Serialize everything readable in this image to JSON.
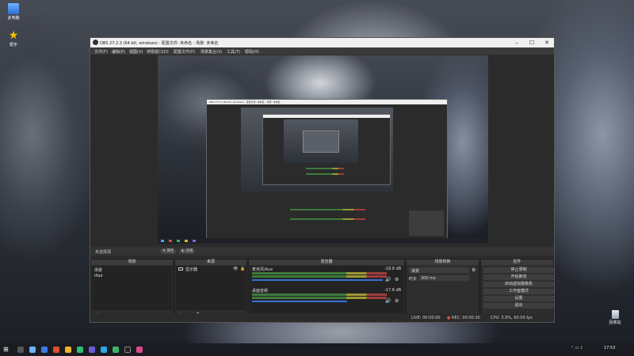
{
  "desktop": {
    "icons": [
      {
        "label": "此电脑"
      },
      {
        "label": "帮手"
      },
      {
        "label": "回收站"
      }
    ]
  },
  "window": {
    "title": "OBS 27.2.3 (64-bit, windows) - 配置文件: 未命名 - 场景: 未命名",
    "controls": {
      "minimize": "–",
      "maximize": "☐",
      "close": "✕"
    }
  },
  "menu": [
    "文件(F)",
    "编辑(E)",
    "视图(V)",
    "停靠窗口(D)",
    "配置文件(P)",
    "场景集合(S)",
    "工具(T)",
    "帮助(H)"
  ],
  "nested_preview": {
    "title": "OBS 27.2.3 (64-bit, windows) - 配置文件: 未命名 - 场景: 未命名"
  },
  "scene_bar": {
    "label": "未选择源",
    "properties": "属性",
    "filters": "滤镜"
  },
  "docks": {
    "scenes": {
      "header": "场景",
      "items": [
        "场景",
        "iPad"
      ],
      "footer": [
        "+",
        "–",
        "∧",
        "∨"
      ]
    },
    "sources": {
      "header": "来源",
      "items": [
        {
          "name": "显示器"
        }
      ],
      "footer": [
        "+",
        "–",
        "⚙",
        "∧",
        "∨"
      ]
    },
    "mixer": {
      "header": "混音器",
      "channels": [
        {
          "name": "麦克风/Aux",
          "db": "-18.8 dB"
        },
        {
          "name": "桌面音频",
          "db": "-17.6 dB"
        }
      ],
      "speaker_icon": "🔊"
    },
    "transitions": {
      "header": "场景转换",
      "type": "渐变",
      "duration_label": "时长",
      "duration": "300 ms"
    },
    "controls": {
      "header": "控件",
      "buttons": [
        "停止录制",
        "开始推流",
        "启动虚拟摄像机",
        "工作室模式",
        "设置",
        "退出"
      ]
    }
  },
  "status": {
    "live": "LIVE: 00:00:00",
    "rec": "REC: 00:00:30",
    "cpu": "CPU: 5.9%, 60.00 fps"
  },
  "taskbar": {
    "time": "17:53",
    "date": ""
  },
  "colors": {
    "obs_bg": "#2b2b2b",
    "meter_green": "#3c7a3c",
    "meter_yellow": "#9a9a32",
    "meter_red": "#a03c3c",
    "volume_blue": "#3a6fd8"
  }
}
